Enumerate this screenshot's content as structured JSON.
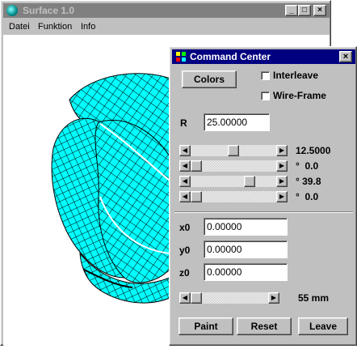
{
  "main_window": {
    "title": "Surface 1.0",
    "caption_minimize": "_",
    "caption_maximize": "□",
    "caption_close": "×",
    "menu": [
      "Datei",
      "Funktion",
      "Info"
    ]
  },
  "surface_colors": {
    "fill": "#00ffff",
    "mesh": "#000000"
  },
  "command_center": {
    "title": "Command Center",
    "close": "×",
    "colors_button": "Colors",
    "interleave": {
      "label": "Interleave",
      "checked": false
    },
    "wireframe": {
      "label": "Wire-Frame",
      "checked": false
    },
    "r_label": "R",
    "r_value": "25.00000",
    "sliders": [
      {
        "value_text": "12.5000",
        "level": 0.5
      },
      {
        "value_text": "°  0.0",
        "level": 0.0
      },
      {
        "value_text": "° 39.8",
        "level": 0.72
      },
      {
        "value_text": "°  0.0",
        "level": 0.0
      }
    ],
    "x0_label": "x0",
    "x0_value": "0.00000",
    "y0_label": "y0",
    "y0_value": "0.00000",
    "z0_label": "z0",
    "z0_value": "0.00000",
    "size_slider": {
      "value_text": "55 mm",
      "level": 0.0
    },
    "paint_button": "Paint",
    "reset_button": "Reset",
    "leave_button": "Leave"
  }
}
